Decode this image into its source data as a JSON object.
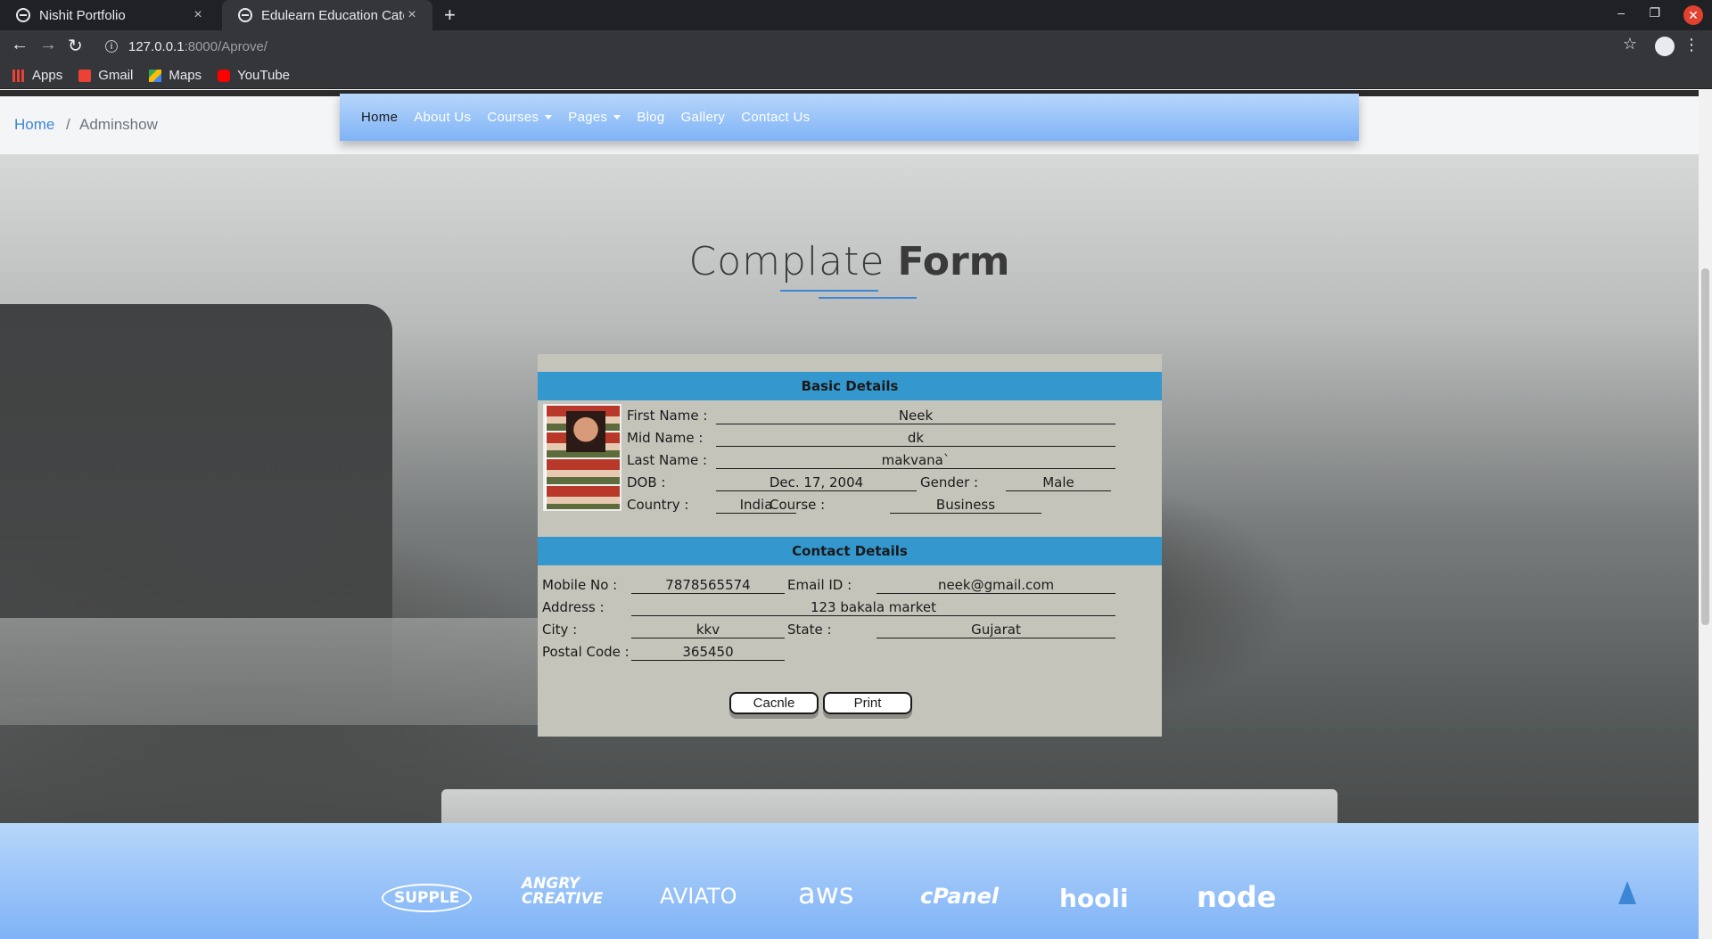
{
  "browser": {
    "tabs": [
      {
        "title": "Nishit Portfolio"
      },
      {
        "title": "Edulearn Education Categ"
      }
    ],
    "close_glyph": "×",
    "new_tab_glyph": "+",
    "minimize_glyph": "–",
    "restore_glyph": "❐",
    "close_window_glyph": "✕",
    "url_host": "127.0.0.1",
    "url_path": ":8000/Aprove/",
    "bookmarks": [
      "Apps",
      "Gmail",
      "Maps",
      "YouTube"
    ]
  },
  "breadcrumb": {
    "home": "Home",
    "separator": "/",
    "current": "Adminshow"
  },
  "nav": {
    "items": [
      "Home",
      "About Us",
      "Courses",
      "Pages",
      "Blog",
      "Gallery",
      "Contact Us"
    ]
  },
  "hero": {
    "title_light": "Complate",
    "title_bold": "Form"
  },
  "form": {
    "basic_title": "Basic Details",
    "contact_title": "Contact Details",
    "labels": {
      "first_name": "First Name :",
      "mid_name": "Mid Name :",
      "last_name": "Last Name :",
      "dob": "DOB :",
      "gender": "Gender :",
      "country": "Country :",
      "course": "Course :",
      "mobile": "Mobile No :",
      "email": "Email ID :",
      "address": "Address :",
      "city": "City :",
      "state": "State :",
      "postal": "Postal Code :"
    },
    "values": {
      "first_name": "Neek",
      "mid_name": "dk",
      "last_name": "makvana`",
      "dob": "Dec. 17, 2004",
      "gender": "Male",
      "country": "India",
      "course": "Business",
      "mobile": "7878565574",
      "email": "neek@gmail.com",
      "address": "123 bakala market",
      "city": "kkv",
      "state": "Gujarat",
      "postal": "365450"
    },
    "cancel_label": "Cacnle",
    "print_label": "Print"
  },
  "partners": [
    "SUPPLE",
    "ANGRY CREATIVE",
    "AVIATO",
    "aws",
    "cPanel",
    "hooli",
    "node"
  ],
  "colors": {
    "nav_gradient_top": "#b7d6fb",
    "section_header": "#3498cf",
    "link": "#3d86d6",
    "form_bg": "#c5c4bb"
  }
}
